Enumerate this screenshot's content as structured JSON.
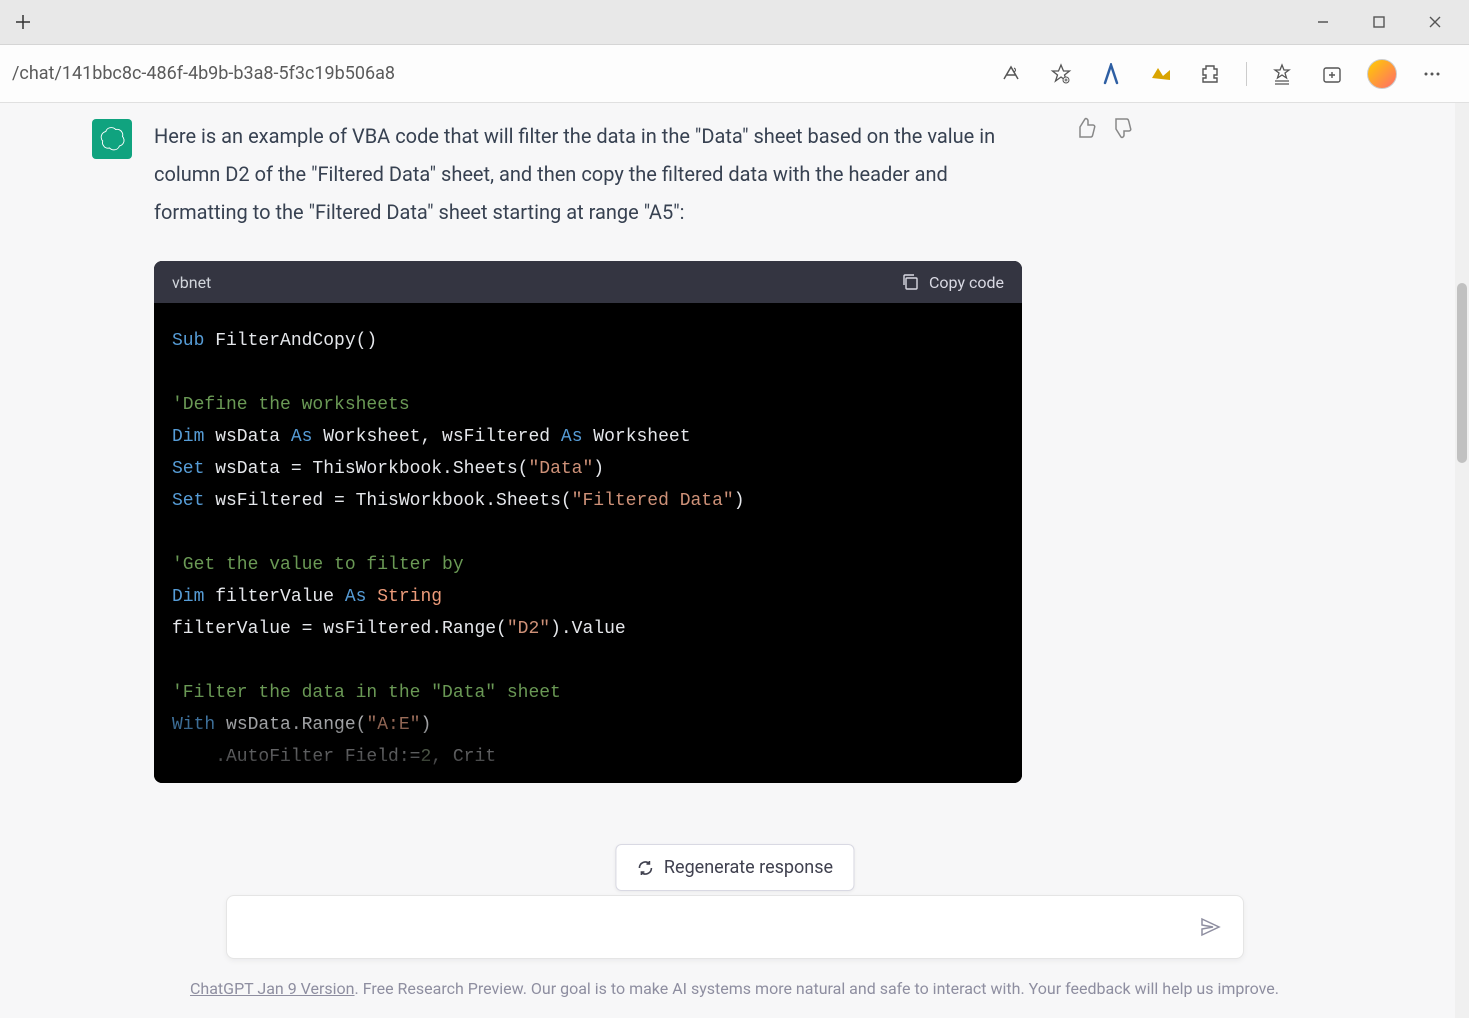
{
  "url": "/chat/141bbc8c-486f-4b9b-b3a8-5f3c19b506a8",
  "message": {
    "intro": "Here is an example of VBA code that will filter the data in the \"Data\" sheet based on the value in column D2 of the \"Filtered Data\" sheet, and then copy the filtered data with the header and formatting to the \"Filtered Data\" sheet starting at range \"A5\":"
  },
  "code": {
    "lang": "vbnet",
    "copy_label": "Copy code",
    "lines": {
      "l1_kw": "Sub",
      "l1_rest": " FilterAndCopy()",
      "l2": "",
      "l3_cm": "'Define the worksheets",
      "l4_kw1": "Dim",
      "l4_p1": " wsData ",
      "l4_kw2": "As",
      "l4_p2": " Worksheet, wsFiltered ",
      "l4_kw3": "As",
      "l4_p3": " Worksheet",
      "l5_kw": "Set",
      "l5_p1": " wsData = ThisWorkbook.Sheets(",
      "l5_str": "\"Data\"",
      "l5_p2": ")",
      "l6_kw": "Set",
      "l6_p1": " wsFiltered = ThisWorkbook.Sheets(",
      "l6_str": "\"Filtered Data\"",
      "l6_p2": ")",
      "l7": "",
      "l8_cm": "'Get the value to filter by",
      "l9_kw1": "Dim",
      "l9_p1": " filterValue ",
      "l9_kw2": "As",
      "l9_typ": " String",
      "l10_p1": "filterValue = wsFiltered.Range(",
      "l10_str": "\"D2\"",
      "l10_p2": ").Value",
      "l11": "",
      "l12_cm": "'Filter the data in the \"Data\" sheet",
      "l13_kw": "With",
      "l13_p1": " wsData.Range(",
      "l13_str": "\"A:E\"",
      "l13_p2": ")",
      "l14_p1": "    .AutoFilter Field:=",
      "l14_num": "2",
      "l14_p2": ", Crit"
    }
  },
  "regenerate_label": "Regenerate response",
  "footer": {
    "link": "ChatGPT Jan 9 Version",
    "text": ". Free Research Preview. Our goal is to make AI systems more natural and safe to interact with. Your feedback will help us improve."
  }
}
